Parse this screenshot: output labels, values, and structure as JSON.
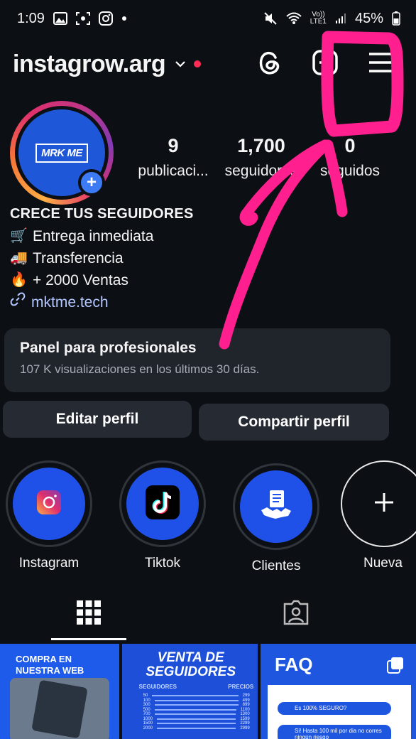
{
  "status_bar": {
    "time": "1:09",
    "network_top": "Vo))",
    "network_bottom": "LTE1",
    "battery": "45%"
  },
  "header": {
    "username": "instagrow.arg"
  },
  "profile": {
    "avatar_logo": "MRK ME",
    "stats": [
      {
        "value": "9",
        "label": "publicaci..."
      },
      {
        "value": "1,700",
        "label": "seguidores"
      },
      {
        "value": "0",
        "label": "seguidos"
      }
    ]
  },
  "bio": {
    "name": "CRECE TUS SEGUIDORES",
    "lines": [
      {
        "emoji": "🛒",
        "text": "Entrega inmediata"
      },
      {
        "emoji": "🚚",
        "text": " Transferencia"
      },
      {
        "emoji": "🔥",
        "text": " + 2000 Ventas"
      }
    ],
    "link": "mktme.tech"
  },
  "panel": {
    "title": "Panel para profesionales",
    "subtitle": "107 K visualizaciones en los últimos 30 días."
  },
  "buttons": {
    "edit": "Editar perfil",
    "share": "Compartir perfil"
  },
  "highlights": [
    {
      "label": "Instagram",
      "icon": "instagram-icon"
    },
    {
      "label": "Tiktok",
      "icon": "tiktok-icon"
    },
    {
      "label": "Clientes",
      "icon": "handshake-icon"
    },
    {
      "label": "Nueva",
      "icon": "plus-icon"
    }
  ],
  "posts": {
    "post1_title_1": "COMPRA EN",
    "post1_title_2": "NUESTRA WEB",
    "post2_title_1": "VENTA DE",
    "post2_title_2": "SEGUIDORES",
    "post2_head_left": "SEGUIDORES",
    "post2_head_right": "PRECIOS",
    "post2_rows": [
      {
        "a": "50",
        "b": "299"
      },
      {
        "a": "100",
        "b": "499"
      },
      {
        "a": "300",
        "b": "899"
      },
      {
        "a": "500",
        "b": "1100"
      },
      {
        "a": "700",
        "b": "1300"
      },
      {
        "a": "1000",
        "b": "1599"
      },
      {
        "a": "1500",
        "b": "2299"
      },
      {
        "a": "2000",
        "b": "2999"
      }
    ],
    "post3_title": "FAQ",
    "post3_q1": "Es 100% SEGURO?",
    "post3_a1": "Si! Hasta 100 mil por dia no corres ningún riesgo"
  },
  "colors": {
    "background": "#0c0f14",
    "card": "#20242b",
    "button": "#262a32",
    "annotation": "#ff1f8e",
    "highlight_fill": "#1f51e8"
  }
}
